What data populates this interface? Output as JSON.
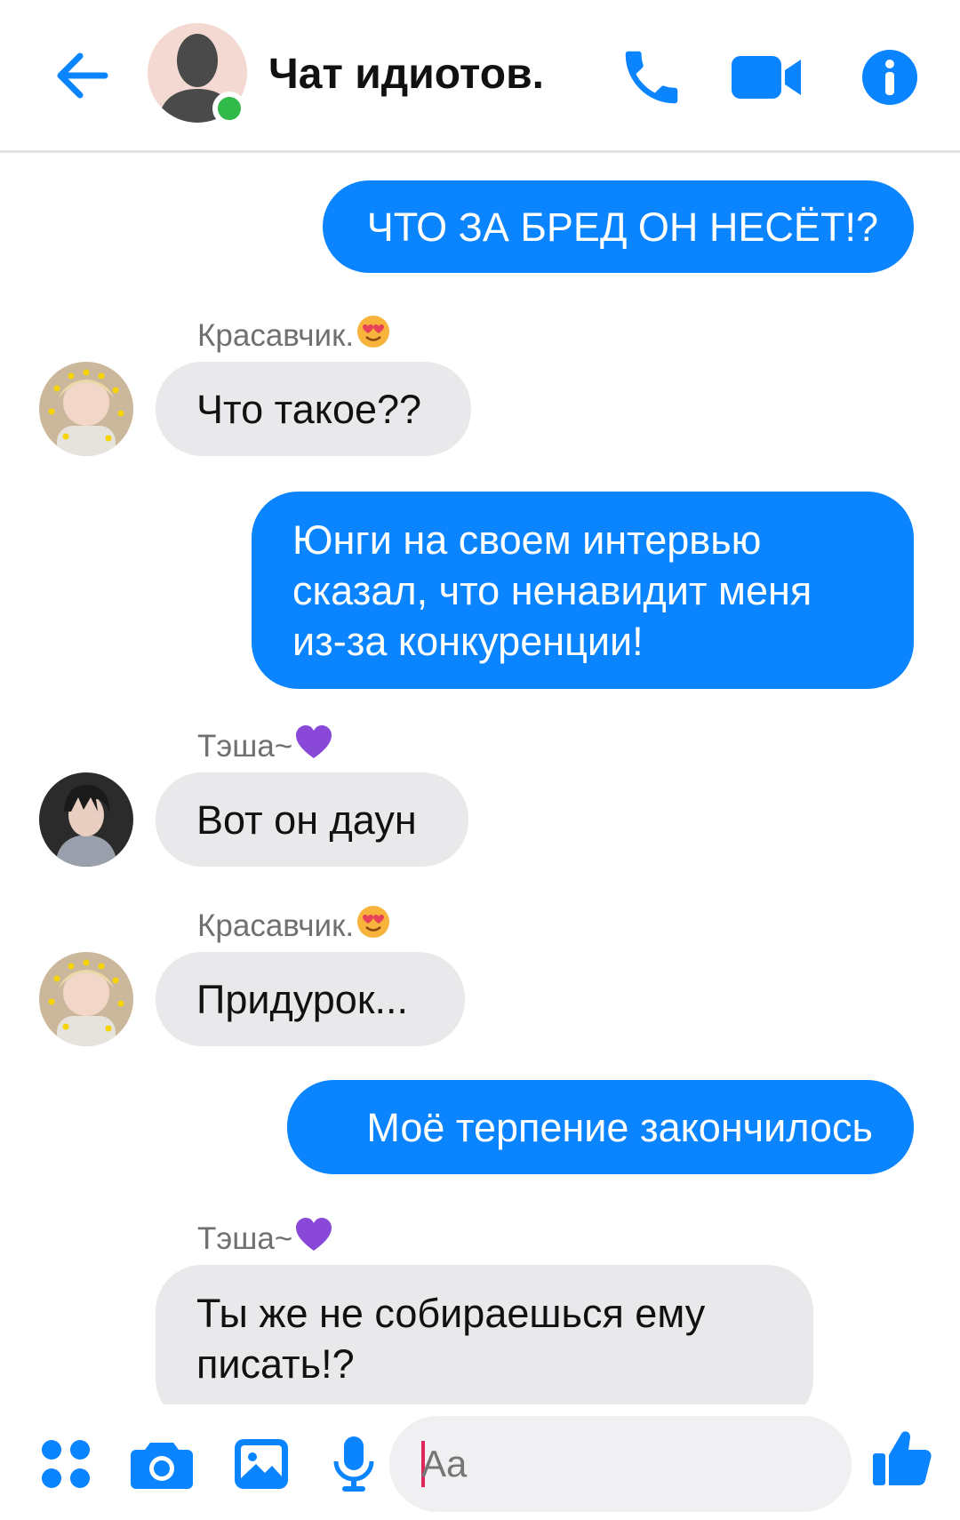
{
  "header": {
    "title": "Чат идиотов.",
    "accent": "#0a84ff",
    "online_color": "#31b94a"
  },
  "messages": [
    {
      "side": "out",
      "text": "ЧТО ЗА БРЕД ОН НЕСЁТ!?"
    },
    {
      "side": "in",
      "sender": "Красавчик.",
      "sender_emoji": "smiling-face-with-heart-eyes",
      "text": "Что такое??"
    },
    {
      "side": "out",
      "lines": [
        "Юнги на своем интервью",
        "сказал, что ненавидит меня",
        "из-за конкуренции!"
      ]
    },
    {
      "side": "in",
      "sender": "Тэша~",
      "sender_emoji": "purple-heart",
      "text": "Вот он даун"
    },
    {
      "side": "in",
      "sender": "Красавчик.",
      "sender_emoji": "smiling-face-with-heart-eyes",
      "text": "Придурок..."
    },
    {
      "side": "out",
      "text": "Моё терпение закончилось"
    },
    {
      "side": "in",
      "sender": "Тэша~",
      "sender_emoji": "purple-heart",
      "lines": [
        "Ты же не собираешься ему",
        "писать!?"
      ]
    }
  ],
  "composer": {
    "placeholder": "Aa",
    "icons": [
      "apps-icon",
      "camera-icon",
      "gallery-icon",
      "microphone-icon",
      "emoji-icon",
      "thumbs-up-icon"
    ]
  }
}
